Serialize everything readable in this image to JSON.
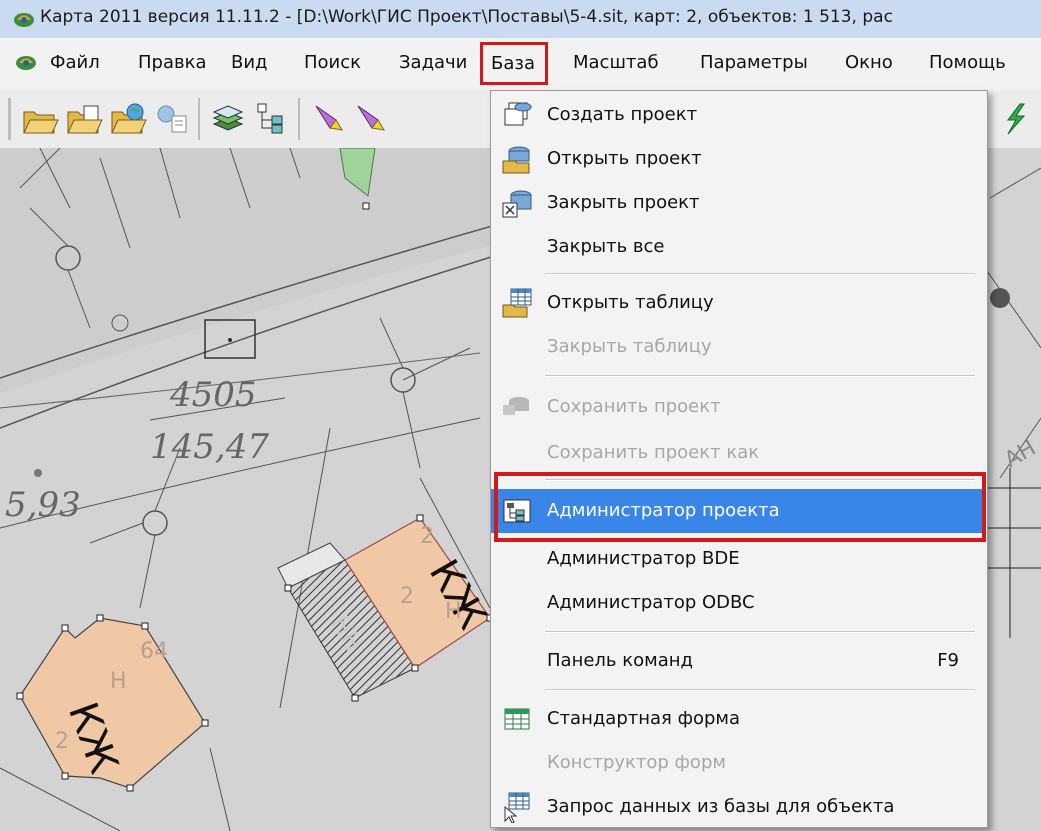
{
  "window": {
    "title": "Карта 2011 версия 11.11.2 - [D:\\Work\\ГИС Проект\\Поставы\\5-4.sit, карт: 2, объектов: 1 513, рас"
  },
  "menubar": {
    "items": [
      {
        "label": "Файл"
      },
      {
        "label": "Правка"
      },
      {
        "label": "Вид"
      },
      {
        "label": "Поиск"
      },
      {
        "label": "Задачи"
      },
      {
        "label": "База"
      },
      {
        "label": "Масштаб"
      },
      {
        "label": "Параметры"
      },
      {
        "label": "Окно"
      },
      {
        "label": "Помощь"
      }
    ],
    "active": "База"
  },
  "dropdown": {
    "items": [
      {
        "label": "Создать проект",
        "icon": "create-project-icon",
        "enabled": true
      },
      {
        "label": "Открыть проект",
        "icon": "open-project-icon",
        "enabled": true
      },
      {
        "label": "Закрыть проект",
        "icon": "close-project-icon",
        "enabled": true
      },
      {
        "label": "Закрыть все",
        "enabled": true
      },
      {
        "label": "Открыть таблицу",
        "icon": "open-table-icon",
        "enabled": true
      },
      {
        "label": "Закрыть таблицу",
        "enabled": false
      },
      {
        "label": "Сохранить проект",
        "icon": "save-project-icon",
        "enabled": false
      },
      {
        "label": "Сохранить проект как",
        "enabled": false
      },
      {
        "label": "Администратор проекта",
        "icon": "project-admin-icon",
        "enabled": true,
        "selected": true
      },
      {
        "label": "Администратор BDE",
        "enabled": true
      },
      {
        "label": "Администратор ODBC",
        "enabled": true
      },
      {
        "label": "Панель команд",
        "shortcut": "F9",
        "enabled": true
      },
      {
        "label": "Стандартная форма",
        "icon": "standard-form-icon",
        "enabled": true
      },
      {
        "label": "Конструктор форм",
        "enabled": false
      },
      {
        "label": "Запрос данных из базы для объекта",
        "icon": "query-data-icon",
        "enabled": true
      }
    ]
  },
  "map": {
    "labels": [
      "4505",
      "145,47",
      "5,93",
      "КЖ",
      "64",
      "2",
      "Н",
      "КЖ",
      "2",
      "НН",
      "2",
      "Н",
      "АН"
    ]
  },
  "colors": {
    "selection": "#3a86e8",
    "highlight": "#d21a1a",
    "building_fill": "#f0c8a6",
    "green_area": "#9ed49a"
  }
}
